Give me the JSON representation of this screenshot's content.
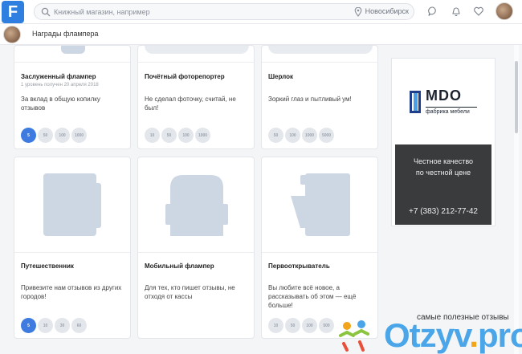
{
  "header": {
    "logo_letter": "F",
    "search_placeholder": "Книжный магазин, например",
    "city": "Новосибирск"
  },
  "subheader": {
    "title": "Награды флампера"
  },
  "cards": [
    {
      "title": "Заслуженный флампер",
      "meta": "1 уровень получен 20 апреля 2018",
      "desc": "За вклад в общую копилку отзывов",
      "levels": [
        "5",
        "50",
        "100",
        "1000"
      ],
      "active": 0
    },
    {
      "title": "Почётный фоторепортер",
      "meta": "",
      "desc": "Не сделал фоточку, считай, не был!",
      "levels": [
        "10",
        "50",
        "100",
        "1000"
      ],
      "active": -1
    },
    {
      "title": "Шерлок",
      "meta": "",
      "desc": "Зоркий глаз и пытливый ум!",
      "levels": [
        "50",
        "100",
        "1000",
        "5000"
      ],
      "active": -1
    },
    {
      "title": "Путешественник",
      "meta": "",
      "desc": "Привезите нам отзывов из других городов!",
      "levels": [
        "5",
        "10",
        "30",
        "60"
      ],
      "active": 0
    },
    {
      "title": "Мобильный флампер",
      "meta": "",
      "desc": "Для тех, кто пишет отзывы, не отходя от кассы",
      "levels": [],
      "active": -1
    },
    {
      "title": "Первооткрыватель",
      "meta": "",
      "desc": "Вы любите всё новое, а рассказывать об этом — ещё больше!",
      "levels": [
        "10",
        "50",
        "100",
        "500"
      ],
      "active": -1
    }
  ],
  "ad": {
    "brand": "MDO",
    "sub": "фабрика мебели",
    "slogan_line1": "Честное качество",
    "slogan_line2": "по честной цене",
    "phone": "+7 (383) 212-77-42"
  },
  "watermark": {
    "tagline": "самые полезные отзывы",
    "brand": "Otzyv",
    "dot": ".",
    "tld": "pro"
  },
  "colors": {
    "accent": "#3d7be0",
    "badge_placeholder": "#cdd6e3",
    "ad_dark": "#3a3b3d"
  }
}
